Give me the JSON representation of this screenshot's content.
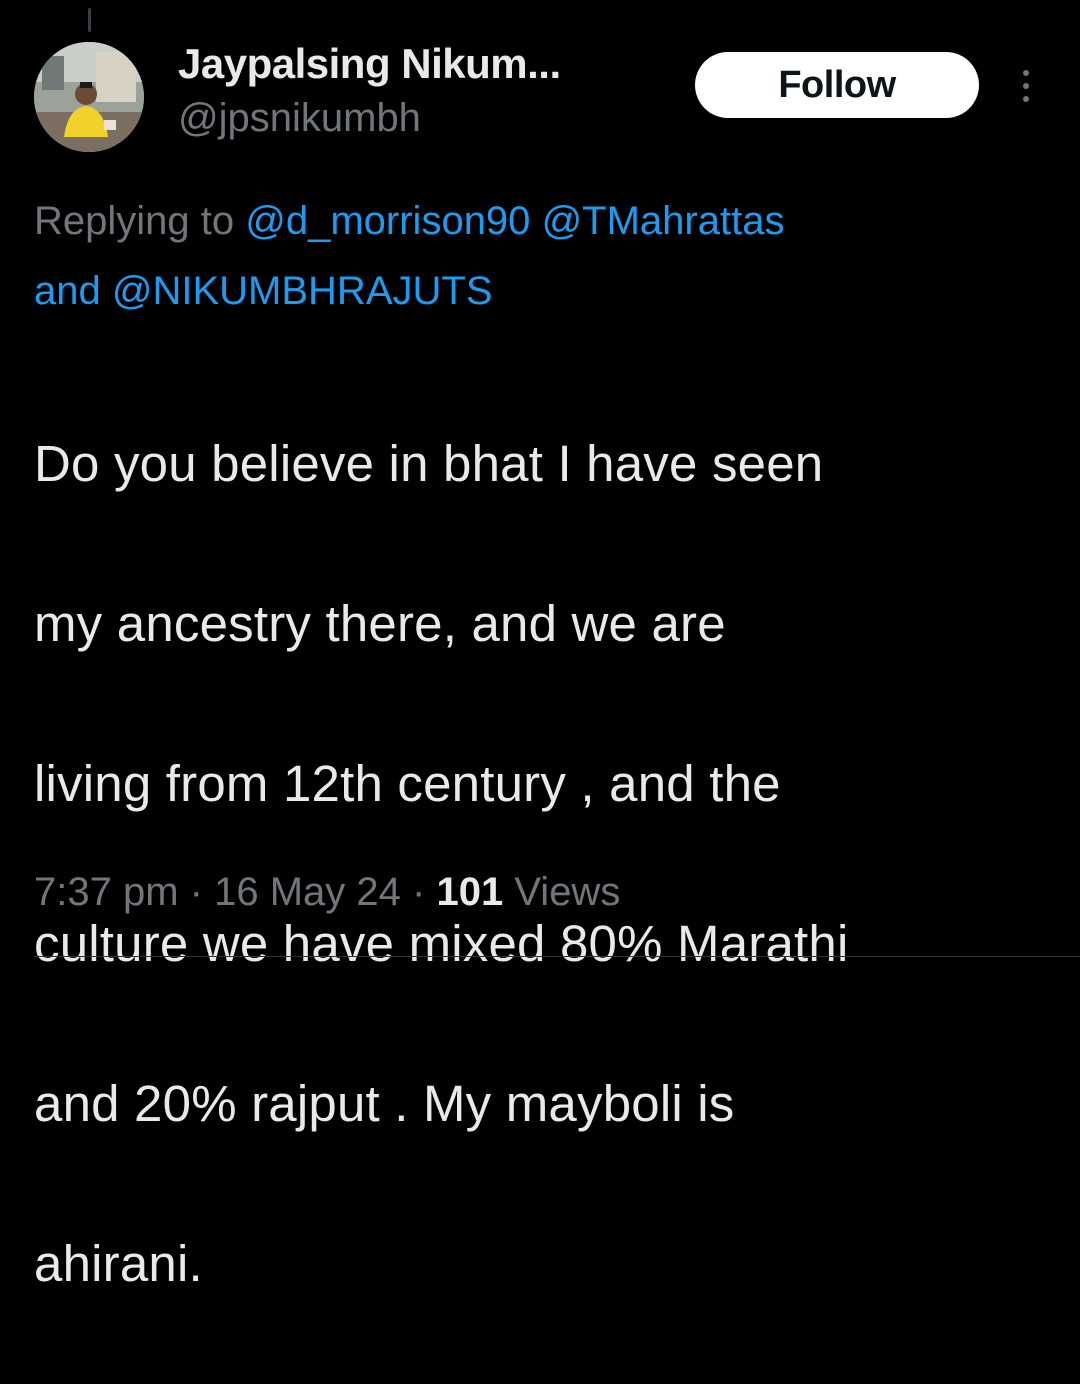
{
  "tweet": {
    "author": {
      "display_name": "Jaypalsing Nikum...",
      "handle": "@jpsnikumbh",
      "avatar_icon": "profile-photo"
    },
    "follow_label": "Follow",
    "more_icon": "vertical-ellipsis-icon",
    "reply_context": {
      "prefix": "Replying to",
      "mentions": [
        "@d_morrison90",
        "@TMahrattas",
        "@NIKUMBHRAJUTS"
      ],
      "joiner": "and"
    },
    "text_lines": [
      "Do you believe in bhat I have seen",
      "my ancestry there, and we are",
      "living from 12th century , and the",
      "culture we have mixed 80% Marathi",
      "and 20% rajput . My mayboli is",
      "ahirani."
    ],
    "meta": {
      "time": "7:37 pm",
      "separator": "·",
      "date": "16 May 24",
      "views_count": "101",
      "views_label": "Views"
    }
  },
  "colors": {
    "background": "#000000",
    "text_primary": "#e7e9ea",
    "text_secondary": "#71767b",
    "accent_link": "#1d9bf0",
    "button_bg": "#ffffff",
    "button_text": "#0f1419"
  }
}
